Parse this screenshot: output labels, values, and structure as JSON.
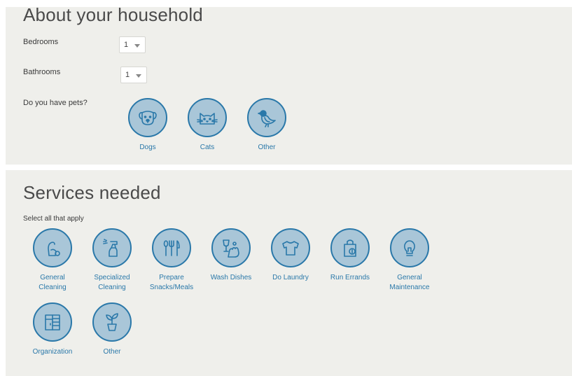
{
  "household": {
    "title": "About your household",
    "bedrooms": {
      "label": "Bedrooms",
      "value": "1"
    },
    "bathrooms": {
      "label": "Bathrooms",
      "value": "1"
    },
    "pets": {
      "label": "Do you have pets?",
      "options": [
        {
          "label": "Dogs",
          "icon": "dog-icon"
        },
        {
          "label": "Cats",
          "icon": "cat-icon"
        },
        {
          "label": "Other",
          "icon": "bird-icon"
        }
      ]
    }
  },
  "services": {
    "title": "Services needed",
    "subtitle": "Select all that apply",
    "options": [
      {
        "line1": "General",
        "line2": "Cleaning",
        "icon": "cleaning-icon"
      },
      {
        "line1": "Specialized",
        "line2": "Cleaning",
        "icon": "spray-bottle-icon"
      },
      {
        "line1": "Prepare",
        "line2": "Snacks/Meals",
        "icon": "utensils-icon"
      },
      {
        "line1": "Wash Dishes",
        "line2": "",
        "icon": "wash-dishes-icon"
      },
      {
        "line1": "Do Laundry",
        "line2": "",
        "icon": "shirt-icon"
      },
      {
        "line1": "Run Errands",
        "line2": "",
        "icon": "shopping-bag-icon"
      },
      {
        "line1": "General",
        "line2": "Maintenance",
        "icon": "lightbulb-icon"
      },
      {
        "line1": "Organization",
        "line2": "",
        "icon": "cabinet-icon"
      },
      {
        "line1": "Other",
        "line2": "",
        "icon": "plant-icon"
      }
    ]
  },
  "colors": {
    "panel_bg": "#efefeb",
    "accent": "#2a78a9",
    "circle_fill": "#a9c6d8"
  }
}
